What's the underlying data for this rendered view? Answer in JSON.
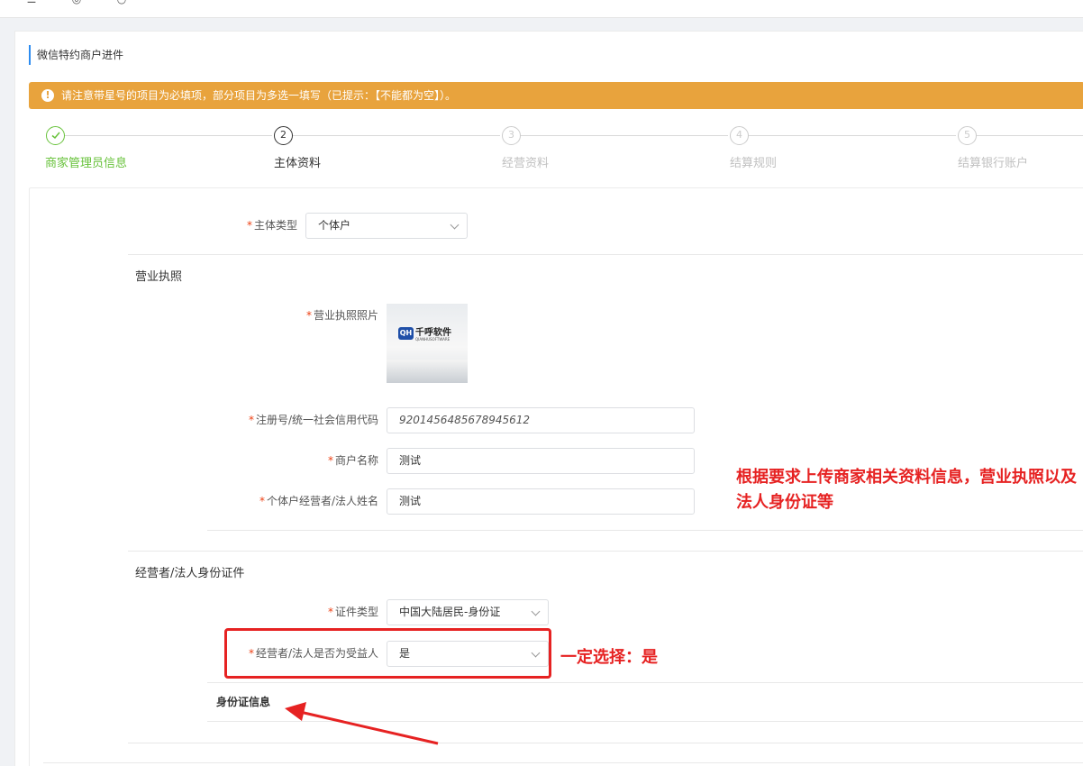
{
  "page_title": "微信特约商户进件",
  "alert": {
    "icon": "!",
    "text": "请注意带星号的项目为必填项，部分项目为多选一填写（已提示：【不能都为空】）。"
  },
  "steps": [
    {
      "number": "",
      "label": "商家管理员信息",
      "state": "done"
    },
    {
      "number": "2",
      "label": "主体资料",
      "state": "active"
    },
    {
      "number": "3",
      "label": "经营资料",
      "state": "pending"
    },
    {
      "number": "4",
      "label": "结算规则",
      "state": "pending"
    },
    {
      "number": "5",
      "label": "结算银行账户",
      "state": "pending"
    }
  ],
  "form": {
    "subject_type": {
      "required": "*",
      "label": "主体类型",
      "value": "个体户"
    },
    "business_license": {
      "section_title": "营业执照",
      "photo_label": "营业执照照片",
      "photo": {
        "logo_mark": "QH",
        "logo_text": "千呼软件",
        "logo_sub": "QIANHUSOFTWARE"
      },
      "reg_no": {
        "label": "注册号/统一社会信用代码",
        "value": "9201456485678945612"
      },
      "merchant_name": {
        "label": "商户名称",
        "value": "测试"
      },
      "legal_name": {
        "label": "个体户经营者/法人姓名",
        "value": "测试"
      }
    },
    "id_section": {
      "section_title": "经营者/法人身份证件",
      "id_type": {
        "label": "证件类型",
        "value": "中国大陆居民-身份证"
      },
      "is_beneficiary": {
        "label": "经营者/法人是否为受益人",
        "value": "是"
      },
      "id_info_title": "身份证信息"
    }
  },
  "annotations": {
    "upload_note": "根据要求上传商家相关资料信息，营业执照以及法人身份证等",
    "select_note": "一定选择：是"
  },
  "colors": {
    "accent": "#2d8cf0",
    "warning": "#e8a33d",
    "success": "#67c23a",
    "annotation_red": "#e62222"
  }
}
